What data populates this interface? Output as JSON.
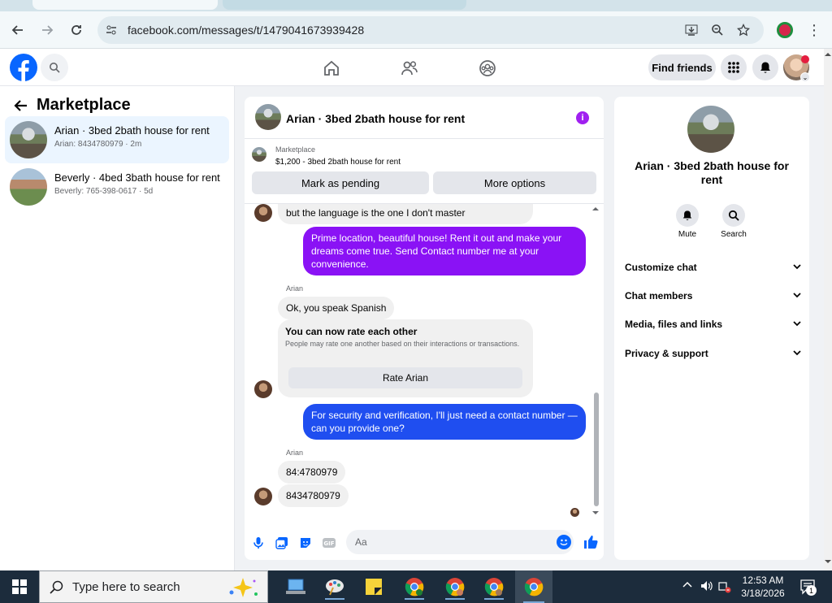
{
  "browser": {
    "url": "facebook.com/messages/t/1479041673939428"
  },
  "topbar": {
    "find_friends": "Find friends"
  },
  "left": {
    "title": "Marketplace",
    "conversations": [
      {
        "name": "Arian · 3bed 2bath house for rent",
        "sub": "Arian: 8434780979 · 2m"
      },
      {
        "name": "Beverly · 4bed 3bath house for rent",
        "sub": "Beverly: 765-398-0617 · 5d"
      }
    ]
  },
  "chat": {
    "title": "Arian · 3bed 2bath house for rent",
    "listing_label": "Marketplace",
    "listing_price": "$1,200 - 3bed 2bath house for rent",
    "mark_pending": "Mark as pending",
    "more_options": "More options",
    "messages": {
      "m1": "but the language is the one I don't master",
      "m2": "Prime location, beautiful house! Rent it out and make your dreams come true. Send  Contact number me at your convenience.",
      "sender1": "Arian",
      "m3": "Ok, you speak Spanish",
      "rate_title": "You can now rate each other",
      "rate_desc": "People may rate one another based on their interactions or transactions.",
      "rate_btn": "Rate Arian",
      "m4": "For security and verification, I'll just need a contact number — can you provide one?",
      "sender2": "Arian",
      "m5": "84:4780979",
      "m6": "8434780979"
    },
    "composer_placeholder": "Aa"
  },
  "right": {
    "title": "Arian · 3bed 2bath house for rent",
    "mute": "Mute",
    "search": "Search",
    "rows": [
      "Customize chat",
      "Chat members",
      "Media, files and links",
      "Privacy & support"
    ]
  },
  "taskbar": {
    "search_placeholder": "Type here to search",
    "time": "12:53 AM",
    "date": "3/18/2026",
    "notif_count": "1"
  },
  "colors": {
    "fb_blue": "#0866ff",
    "purple_bubble": "#8a12f5",
    "blue_bubble": "#1f4ef0"
  }
}
